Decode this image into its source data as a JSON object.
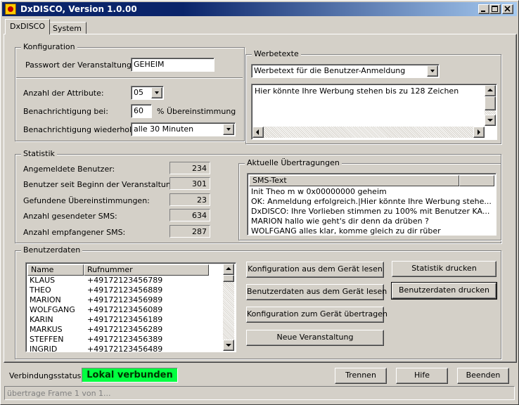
{
  "window": {
    "title": "DxDISCO, Version 1.0.00"
  },
  "tabs": [
    {
      "label": "DxDISCO"
    },
    {
      "label": "System"
    }
  ],
  "konfiguration": {
    "legend": "Konfiguration",
    "password_label": "Passwort der Veranstaltung:",
    "password_value": "GEHEIM",
    "attributes_label": "Anzahl der Attribute:",
    "attributes_value": "05",
    "notify_label": "Benachrichtigung bei:",
    "notify_value": "60",
    "notify_unit": "% Übereinstimmung",
    "repeat_label": "Benachrichtigung wiederholen:",
    "repeat_value": "alle 30 Minuten"
  },
  "werbetexte": {
    "legend": "Werbetexte",
    "select_value": "Werbetext für die Benutzer-Anmeldung",
    "text": "Hier könnte Ihre Werbung stehen bis zu 128 Zeichen"
  },
  "statistik": {
    "legend": "Statistik",
    "rows": [
      {
        "label": "Angemeldete Benutzer:",
        "value": "234"
      },
      {
        "label": "Benutzer seit Beginn der Veranstaltung:",
        "value": "301"
      },
      {
        "label": "Gefundene Übereinstimmungen:",
        "value": "23"
      },
      {
        "label": "Anzahl gesendeter SMS:",
        "value": "634"
      },
      {
        "label": "Anzahl empfangener SMS:",
        "value": "287"
      }
    ]
  },
  "uebertragungen": {
    "legend": "Aktuelle Übertragungen",
    "column": "SMS-Text",
    "rows": [
      "Init Theo m w 0x00000000 geheim",
      "OK: Anmeldung erfolgreich.|Hier könnte Ihre Werbung stehe...",
      "DxDISCO: Ihre Vorlieben stimmen zu 100% mit Benutzer KA...",
      "MARION hallo wie geht's dir denn da drüben ?",
      "WOLFGANG alles klar, komme gleich zu dir rüber"
    ]
  },
  "benutzerdaten": {
    "legend": "Benutzerdaten",
    "columns": {
      "name": "Name",
      "number": "Rufnummer"
    },
    "rows": [
      {
        "name": "KLAUS",
        "number": "+49172123456789"
      },
      {
        "name": "THEO",
        "number": "+49172123456889"
      },
      {
        "name": "MARION",
        "number": "+49172123456989"
      },
      {
        "name": "WOLFGANG",
        "number": "+49172123456089"
      },
      {
        "name": "KARIN",
        "number": "+49172123456189"
      },
      {
        "name": "MARKUS",
        "number": "+49172123456289"
      },
      {
        "name": "STEFFEN",
        "number": "+49172123456389"
      },
      {
        "name": "INGRID",
        "number": "+49172123456489"
      }
    ],
    "buttons": {
      "read_config": "Konfiguration aus dem Gerät lesen",
      "read_users": "Benutzerdaten aus dem Gerät lesen",
      "write_config": "Konfiguration zum Gerät übertragen",
      "new_event": "Neue Veranstaltung",
      "print_stats": "Statistik drucken",
      "print_users": "Benutzerdaten drucken"
    }
  },
  "footer": {
    "status_label": "Verbindungsstatus:",
    "status_value": "Lokal verbunden",
    "status_color": "#00ff40",
    "disconnect": "Trennen",
    "help": "Hife",
    "exit": "Beenden",
    "statusbar_text": "übertrage Frame 1 von 1..."
  }
}
